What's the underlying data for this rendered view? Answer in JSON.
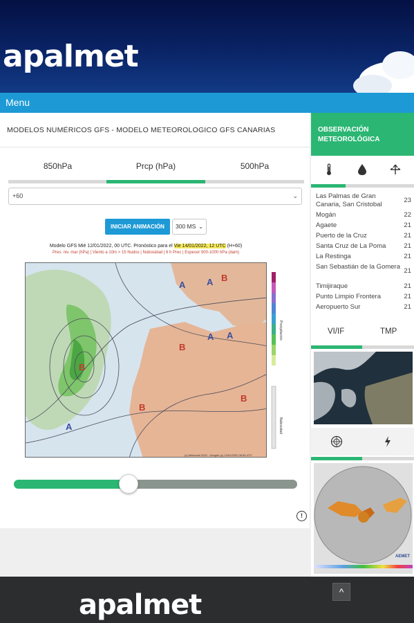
{
  "brand": {
    "logo_text": "apalmet"
  },
  "menu": {
    "label": "Menu"
  },
  "main": {
    "title": "MODELOS NUMÉRICOS GFS - MODELO METEOROLOGICO GFS CANARIAS",
    "tabs": [
      {
        "label": "850hPa",
        "active": false
      },
      {
        "label": "Prcp (hPa)",
        "active": true
      },
      {
        "label": "500hPa",
        "active": false
      }
    ],
    "forecast_select": {
      "value": "+60"
    },
    "animation_button": "INICIAR ANIMACIÓN",
    "speed_select": {
      "value": "300 MS"
    },
    "map": {
      "header_line1_pre": "Modelo GFS Mié 12/01/2022, 00 UTC. Pronóstico para el",
      "header_highlight": "Vie 14/01/2022, 12 UTC",
      "header_line1_post": "(H+60)",
      "header_line2": "Pres. niv. mar (hPa) | Viento a 10m > 15 Nudos | Nubosidad | 6 h Prec | Espesor 500-1000 hPa (dam)",
      "scale_label_precip": "Precipitación",
      "scale_label_cloud": "Nubosidad",
      "credit": "(c) Meteociel 2022 - Ubugrib (c) 12/01/2022 08:35 UTC",
      "pressure_labels": [
        "A",
        "A",
        "B",
        "B",
        "B",
        "A",
        "B",
        "A",
        "B",
        "A"
      ]
    },
    "slider": {
      "position": 0.38
    }
  },
  "sidebar": {
    "title": "OBSERVACIÓN METEOROLÓGICA",
    "icons": [
      "thermometer-icon",
      "drop-icon",
      "wind-icon"
    ],
    "stations": [
      {
        "name": "Las Palmas de Gran Canaria, San Cristobal",
        "value": "23"
      },
      {
        "name": "Mogán",
        "value": "22"
      },
      {
        "name": "Agaete",
        "value": "21"
      },
      {
        "name": "Puerto de la Cruz",
        "value": "21"
      },
      {
        "name": "Santa Cruz de La Poma",
        "value": "21"
      },
      {
        "name": "La Restinga",
        "value": "21"
      },
      {
        "name": "San Sebastián de la Gomera",
        "value": "21"
      },
      {
        "name": "Timijiraque",
        "value": "21"
      },
      {
        "name": "Punto Limpio Frontera",
        "value": "21"
      },
      {
        "name": "Aeropuerto Sur",
        "value": "21"
      }
    ],
    "image_tabs": [
      "VI/IF",
      "TMP"
    ],
    "bottom_icons": [
      "radar-icon",
      "lightning-icon"
    ],
    "radar_logo": "AEMET"
  },
  "footer": {
    "logo_text": "apalmet",
    "top_button": "^"
  },
  "colors": {
    "accent_green": "#2bb673",
    "accent_blue": "#1d9ad6",
    "header_navy": "#041043",
    "footer_dark": "#2b2d2f"
  }
}
